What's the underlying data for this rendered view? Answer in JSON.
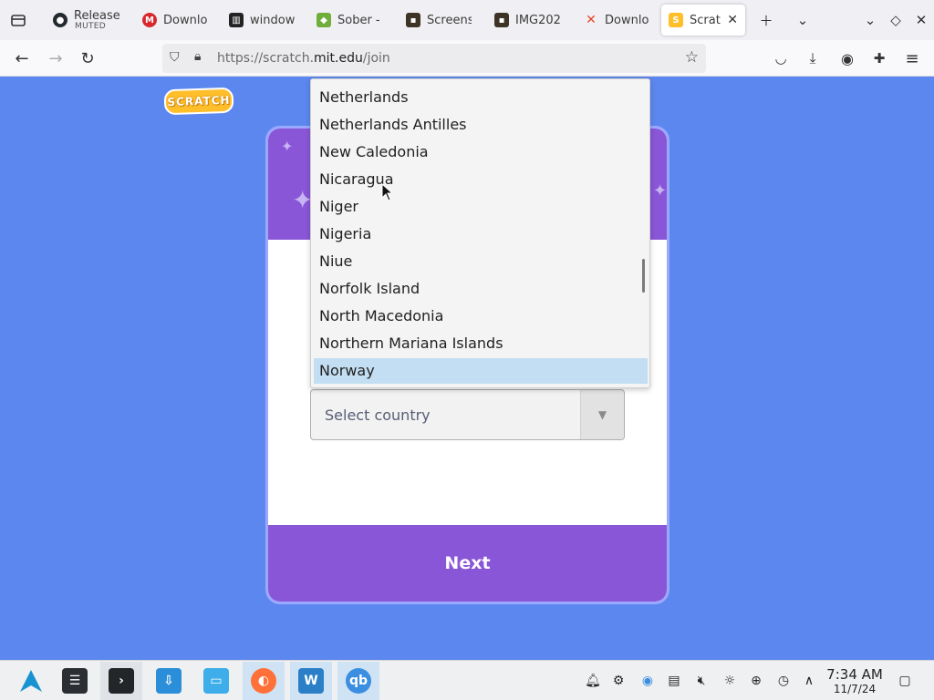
{
  "browser": {
    "tabs": [
      {
        "title": "Release",
        "sub": "MUTED",
        "icon": "github-icon"
      },
      {
        "title": "Downlo",
        "icon": "mega-icon"
      },
      {
        "title": "window",
        "icon": "archive-icon"
      },
      {
        "title": "Sober -",
        "icon": "sober-icon"
      },
      {
        "title": "Screens",
        "icon": "image-icon"
      },
      {
        "title": "IMG202",
        "icon": "image-icon"
      },
      {
        "title": "Downlo",
        "icon": "x-icon"
      },
      {
        "title": "Scratc",
        "icon": "scratch-icon",
        "active": true
      }
    ],
    "url_prefix": "https://scratch.",
    "url_domain": "mit.edu",
    "url_path": "/join"
  },
  "page": {
    "next_label": "Next",
    "select_placeholder": "Select country",
    "dropdown_options": [
      "Netherlands",
      "Netherlands Antilles",
      "New Caledonia",
      "Nicaragua",
      "Niger",
      "Nigeria",
      "Niue",
      "Norfolk Island",
      "North Macedonia",
      "Northern Mariana Islands",
      "Norway"
    ],
    "selected_option": "Norway",
    "colors": {
      "background": "#5c87ee",
      "header": "#8a56d8",
      "selected": "#c3def2"
    }
  },
  "taskbar": {
    "time": "7:34 AM",
    "date": "11/7/24"
  }
}
